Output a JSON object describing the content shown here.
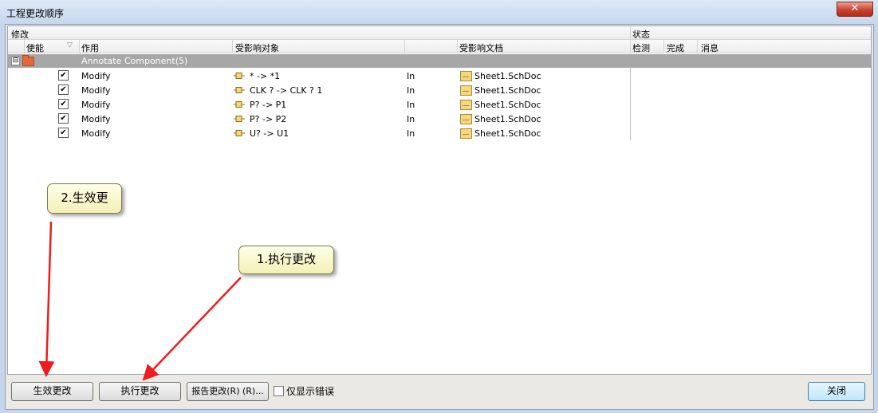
{
  "window": {
    "title": "工程更改顺序",
    "close_glyph": "✕"
  },
  "header": {
    "group_modify": "修改",
    "group_status": "状态",
    "columns": [
      "使能",
      "作用",
      "受影响对象",
      "受影响文档",
      "检测",
      "完成",
      "消息"
    ]
  },
  "group": {
    "label": "Annotate Component(5)",
    "expander": "⊟"
  },
  "rows": [
    {
      "enabled": true,
      "action": "Modify",
      "object": "* -> *1",
      "direction": "In",
      "document": "Sheet1.SchDoc"
    },
    {
      "enabled": true,
      "action": "Modify",
      "object": "CLK ? -> CLK ? 1",
      "direction": "In",
      "document": "Sheet1.SchDoc"
    },
    {
      "enabled": true,
      "action": "Modify",
      "object": "P? -> P1",
      "direction": "In",
      "document": "Sheet1.SchDoc"
    },
    {
      "enabled": true,
      "action": "Modify",
      "object": "P? -> P2",
      "direction": "In",
      "document": "Sheet1.SchDoc"
    },
    {
      "enabled": true,
      "action": "Modify",
      "object": "U? -> U1",
      "direction": "In",
      "document": "Sheet1.SchDoc"
    }
  ],
  "check_glyph": "✔",
  "buttons": {
    "validate": "生效更改",
    "execute": "执行更改",
    "report": "报告更改(R) (R)...",
    "only_errors": "仅显示错误",
    "close": "关闭"
  },
  "callouts": {
    "step1": "1.执行更改",
    "step2": "2.生效更"
  },
  "colors": {
    "annotation_arrow": "#ee1c1c",
    "group_row": "#a7a7a7"
  }
}
